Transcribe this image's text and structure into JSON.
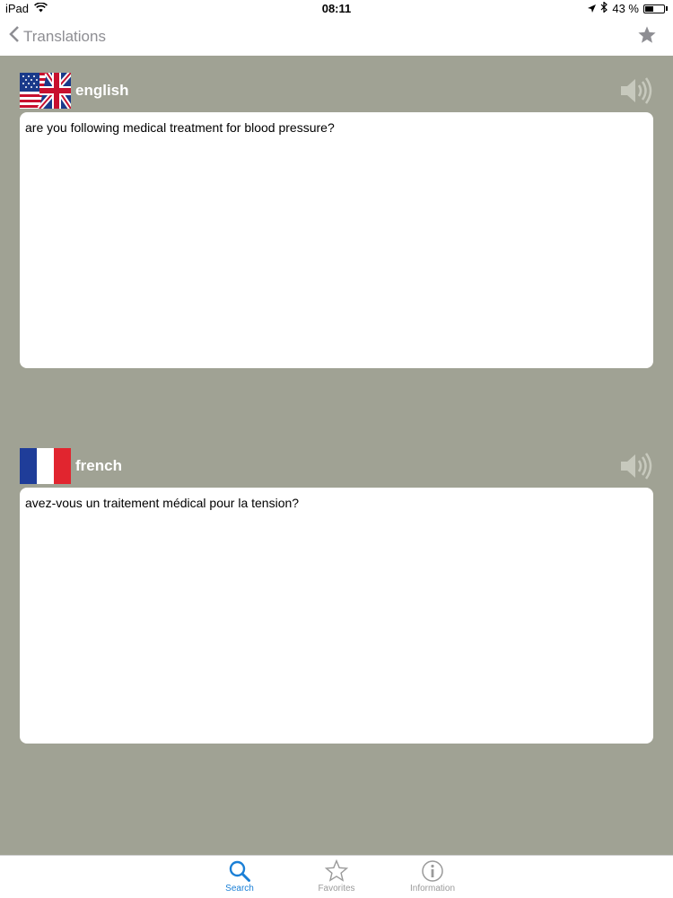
{
  "status_bar": {
    "device": "iPad",
    "time": "08:11",
    "battery": "43 %",
    "battery_level": 0.43
  },
  "nav": {
    "back_label": "Translations",
    "favorite_icon": "star-icon"
  },
  "source": {
    "language": "english",
    "flag": "uk-us-flag",
    "text": "are you following medical treatment for blood pressure?"
  },
  "target": {
    "language": "french",
    "flag": "france-flag",
    "text": "avez-vous un traitement médical pour la tension?"
  },
  "tabs": [
    {
      "label": "Search",
      "icon": "search-icon",
      "active": true
    },
    {
      "label": "Favorites",
      "icon": "star-outline-icon",
      "active": false
    },
    {
      "label": "Information",
      "icon": "info-icon",
      "active": false
    }
  ],
  "colors": {
    "background": "#a0a294",
    "accent": "#1a7fd6",
    "inactive": "#9a9a9a"
  }
}
